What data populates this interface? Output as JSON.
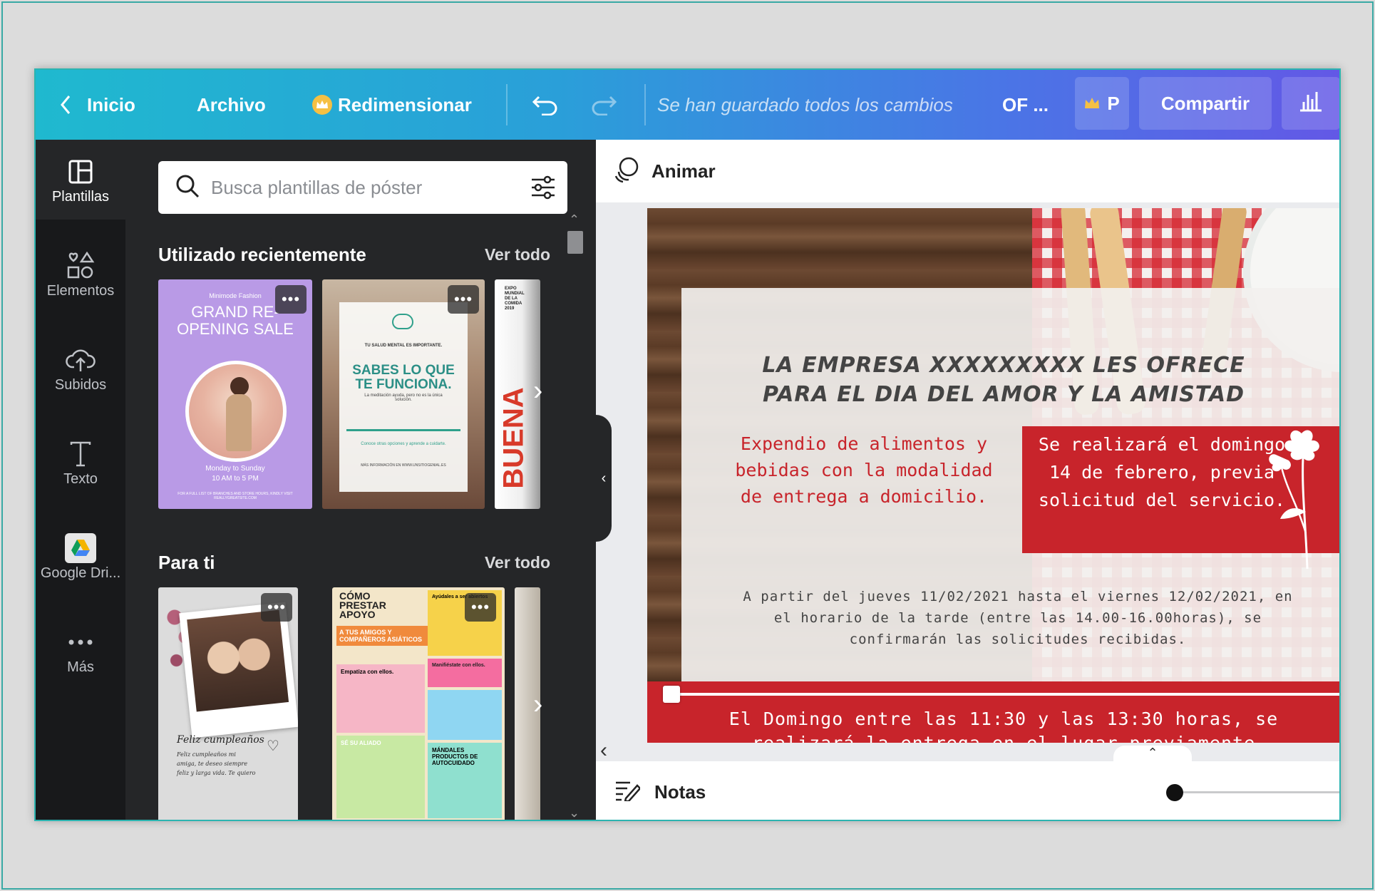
{
  "topbar": {
    "home_label": "Inicio",
    "file_label": "Archivo",
    "resize_label": "Redimensionar",
    "saved_status": "Se han guardado todos los cambios",
    "doc_title": "OF ...",
    "pro_label": "P",
    "share_label": "Compartir",
    "accent_colors": [
      "#1fb9cf",
      "#4b74e6",
      "#6358e6"
    ]
  },
  "sidebar": {
    "items": [
      {
        "label": "Plantillas",
        "icon": "layout-icon"
      },
      {
        "label": "Elementos",
        "icon": "shapes-icon"
      },
      {
        "label": "Subidos",
        "icon": "cloud-upload-icon"
      },
      {
        "label": "Texto",
        "icon": "text-icon"
      },
      {
        "label": "Google Dri...",
        "icon": "google-drive-icon"
      },
      {
        "label": "Más",
        "icon": "more-icon"
      }
    ]
  },
  "panel": {
    "search_placeholder": "Busca plantillas de póster",
    "recent": {
      "title": "Utilizado recientemente",
      "see_all": "Ver todo",
      "templates": [
        {
          "brand": "Minimode Fashion",
          "title": "GRAND RE-OPENING SALE",
          "date": "Monday to Sunday",
          "hours": "10 AM to 5 PM",
          "footer": "FOR A FULL LIST OF BRANCHES AND STORE HOURS, KINDLY VISIT REALLYGREATSITE.COM"
        },
        {
          "kicker": "TU SALUD MENTAL ES IMPORTANTE.",
          "title": "SABES LO QUE TE FUNCIONA.",
          "body": "La meditación ayuda, pero no es la única solución.",
          "cta": "Conoce otras opciones y aprende a cuidarte.",
          "footer": "MÁS INFORMACIÓN EN WWW.UNSITIOGENIAL.ES"
        },
        {
          "kicker": "EXPO MUNDIAL DE LA COMIDA 2019",
          "title": "BUENA"
        }
      ]
    },
    "for_you": {
      "title": "Para ti",
      "see_all": "Ver todo",
      "templates": [
        {
          "title": "Feliz cumpleaños",
          "body": "Feliz cumpleaños mi amiga, te deseo siempre feliz y larga vida. Te quiero"
        },
        {
          "title": "CÓMO PRESTAR APOYO",
          "subtitle": "A TUS AMIGOS Y COMPAÑEROS ASIÁTICOS",
          "blocks": [
            "Ayúdales a ser abiertos",
            "Empatiza con ellos.",
            "Manifiéstate con ellos.",
            "SÉ SU ALIADO",
            "MÁNDALES PRODUCTOS DE AUTOCUIDADO"
          ]
        }
      ]
    }
  },
  "editor": {
    "animate_label": "Animar",
    "notes_label": "Notas",
    "poster": {
      "headline": "LA EMPRESA  XXXXXXXXX LES OFRECE PARA EL DIA DEL AMOR Y LA AMISTAD",
      "left_text": "Expendio de alimentos y bebidas con la modalidad de entrega a domicilio.",
      "red_box_text": "Se realizará el domingo 14 de febrero, previa solicitud del servicio.",
      "paragraph": "A partir del jueves 11/02/2021 hasta el viernes 12/02/2021, en el horario de la tarde (entre las 14.00-16.00horas), se confirmarán las solicitudes recibidas.",
      "footer_line1": "El Domingo entre las 11:30 y las 13:30 horas, se",
      "footer_line2": "realizará la entrega en el lugar previamente",
      "red": "#c8242b"
    }
  }
}
